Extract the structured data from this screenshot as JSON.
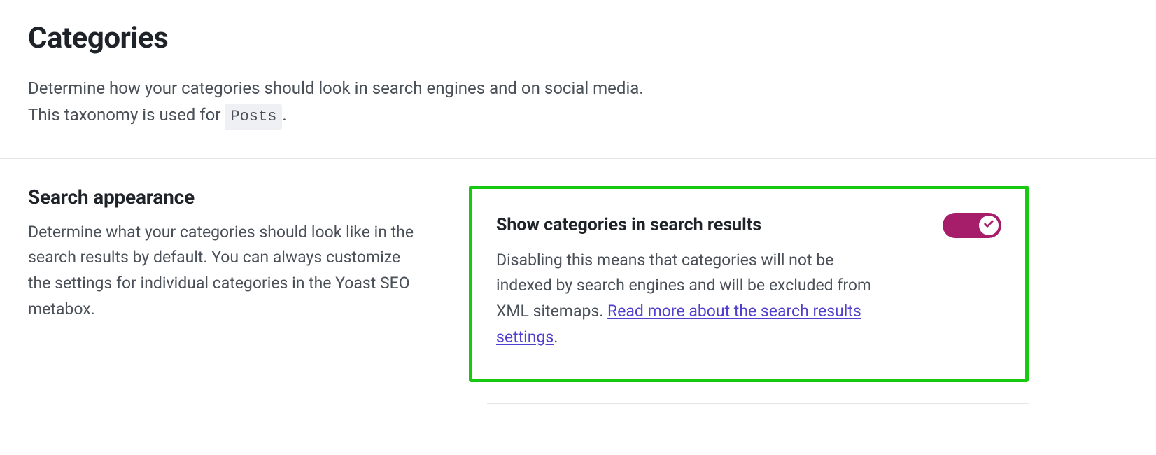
{
  "header": {
    "title": "Categories",
    "intro_line1": "Determine how your categories should look in search engines and on social media.",
    "intro_prefix": "This taxonomy is used for ",
    "intro_tag": "Posts",
    "intro_suffix": "."
  },
  "section": {
    "title": "Search appearance",
    "description": "Determine what your categories should look like in the search results by default. You can always customize the settings for individual categories in the Yoast SEO metabox."
  },
  "setting": {
    "title": "Show categories in search results",
    "desc_prefix": "Disabling this means that categories will not be indexed by search engines and will be excluded from XML sitemaps. ",
    "link_text": "Read more about the search results settings",
    "desc_suffix": ".",
    "toggle_checked": true
  },
  "colors": {
    "highlight_border": "#18c912",
    "toggle_on": "#a61e69",
    "link": "#4f3fcf"
  }
}
